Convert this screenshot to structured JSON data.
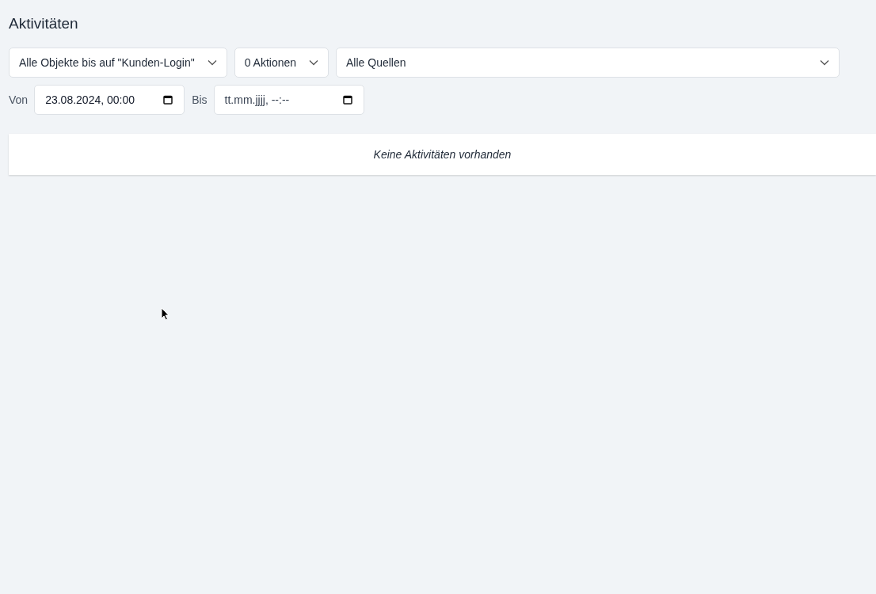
{
  "title": "Aktivitäten",
  "filters": [
    {
      "value": "Alle Objekte bis auf \"Kunden-Login\"",
      "kind": "compact"
    },
    {
      "value": "0 Aktionen",
      "kind": "compact"
    },
    {
      "value": "Alle Quellen",
      "kind": "wide"
    }
  ],
  "date_range": [
    {
      "label": "Von",
      "value": "23.08.2024, 00:00",
      "empty": false
    },
    {
      "label": "Bis",
      "placeholder": "tt.mm.jjjj, --:--",
      "empty": true
    }
  ],
  "empty_message": "Keine Aktivitäten vorhanden"
}
